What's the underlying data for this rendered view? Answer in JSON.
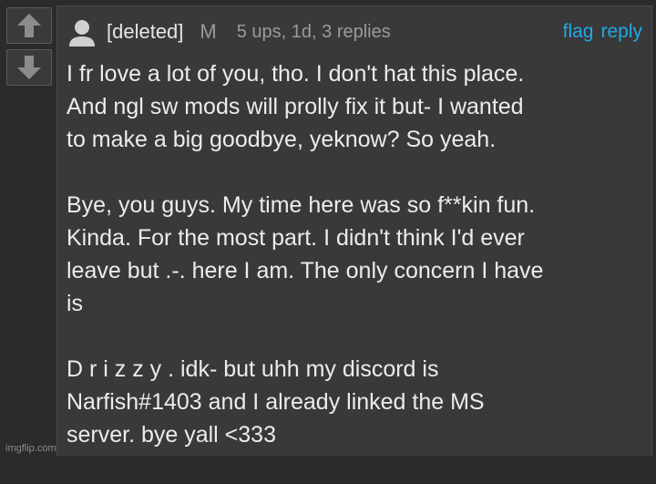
{
  "vote": {
    "up_icon": "arrow-up-icon",
    "down_icon": "arrow-down-icon"
  },
  "comment": {
    "avatar_icon": "user-avatar-icon",
    "username": "[deleted]",
    "badge": "M",
    "meta": "5 ups, 1d, 3 replies",
    "actions": {
      "flag": "flag",
      "reply": "reply"
    },
    "paragraphs": [
      "I fr love a lot of you, tho. I don't hat this place.\nAnd ngl sw mods will prolly fix it but- I wanted\nto make a big goodbye, yeknow? So yeah.",
      "Bye, you guys. My time here was so f**kin fun.\nKinda. For the most part. I didn't think I'd ever\nleave but .-. here I am. The only concern I have\nis",
      "D r i z z y . idk- but uhh my discord is\nNarfish#1403 and I already linked the MS\nserver. bye yall <333"
    ]
  },
  "watermark": "imgflip.com",
  "colors": {
    "background": "#2b2b2b",
    "card": "#393939",
    "link": "#23a7e6",
    "text": "#ececec",
    "muted": "#9a9a9a"
  }
}
